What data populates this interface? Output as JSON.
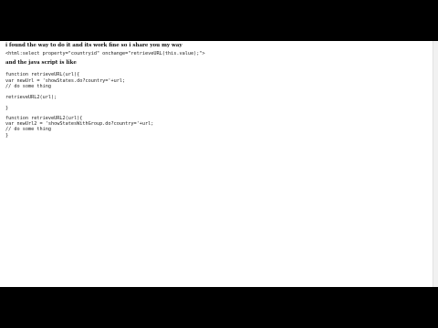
{
  "post": {
    "intro": "i found the way to do it and its work fine so i share you my way",
    "tag_line": "<html:select property=\"countryid\" onchange=\"retrieveURL(this.value);\">",
    "lead": "and the java script is like",
    "code": [
      "function retrieveURL(url){",
      "var newUrl = 'showStates.do?country='+url;",
      "// do some thing",
      "",
      "retrieveURL2(url);",
      "",
      "}",
      "function retrieveURL2(url){",
      "var newUrl2 = 'showStatesWithGroup.do?country='+url;",
      "// do some thing",
      "}"
    ]
  },
  "colors": {
    "letterbox": "#000000",
    "page": "#ffffff",
    "text": "#111111"
  }
}
